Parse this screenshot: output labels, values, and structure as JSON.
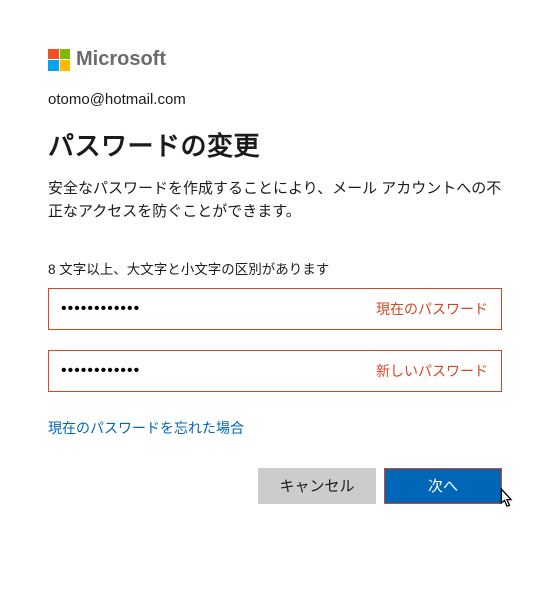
{
  "logo": {
    "text": "Microsoft"
  },
  "email": "otomo@hotmail.com",
  "title": "パスワードの変更",
  "description": "安全なパスワードを作成することにより、メール アカウントへの不正なアクセスを防ぐことができます。",
  "password_hint": "8 文字以上、大文字と小文字の区別があります",
  "fields": {
    "current": {
      "label": "現在のパスワード",
      "value": "●●●●●●●●●●●●"
    },
    "new": {
      "label": "新しいパスワード",
      "value": "●●●●●●●●●●●●"
    }
  },
  "forgot_link": "現在のパスワードを忘れた場合",
  "buttons": {
    "cancel": "キャンセル",
    "next": "次へ"
  }
}
